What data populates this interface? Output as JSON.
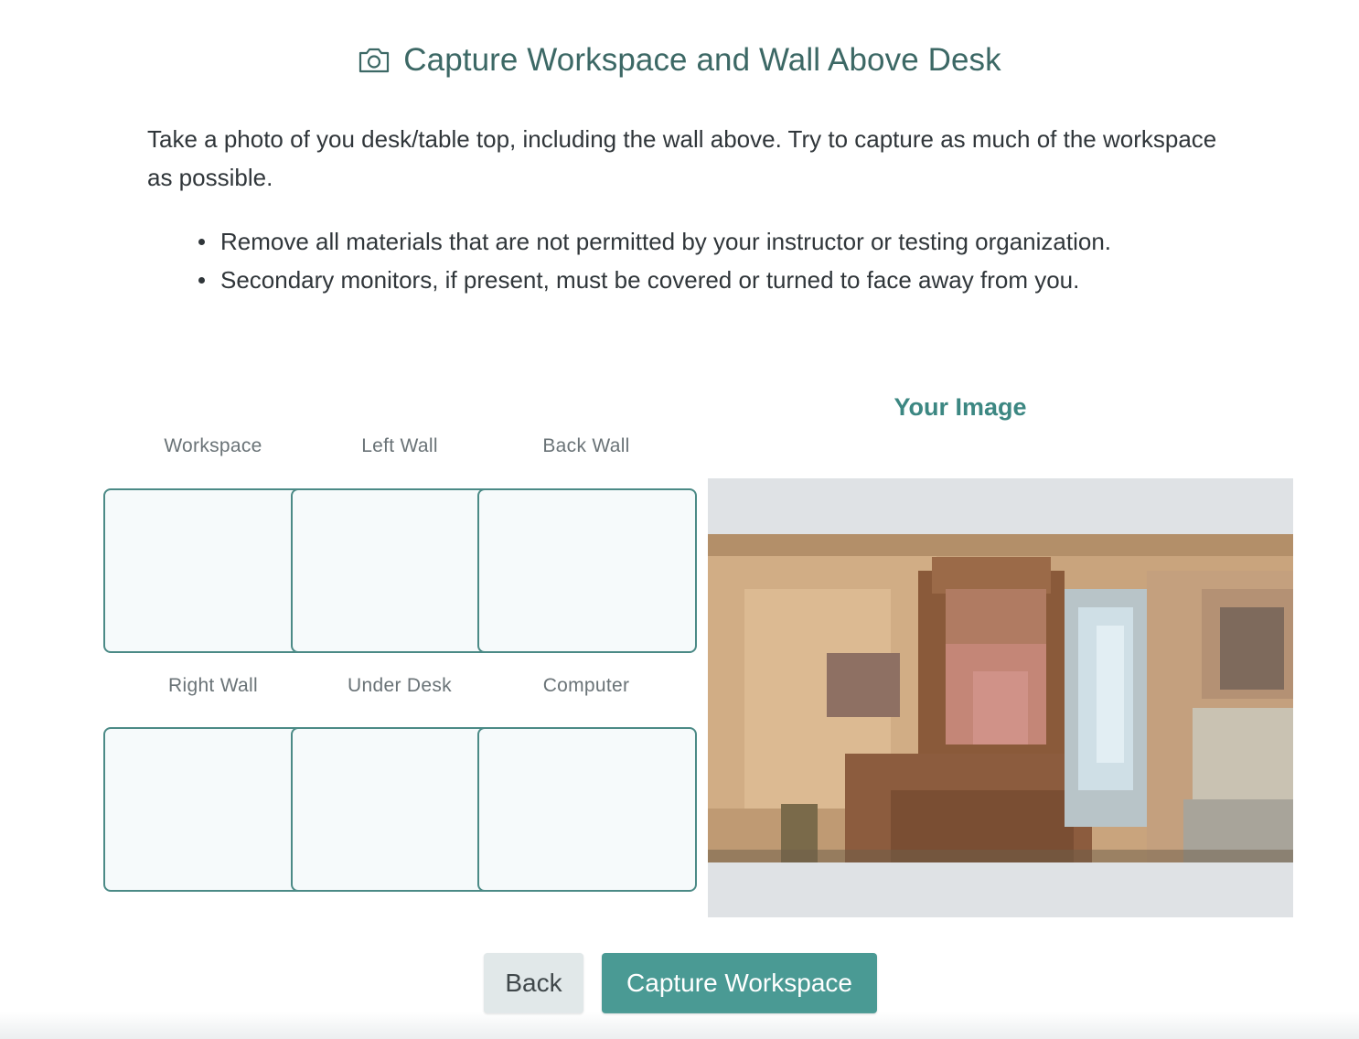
{
  "header": {
    "icon": "camera-icon",
    "title": "Capture Workspace and Wall Above Desk"
  },
  "instructions": {
    "intro": "Take a photo of you desk/table top, including the wall above. Try to capture as much of the workspace as possible.",
    "rules": [
      "Remove all materials that are not permitted by your instructor or testing organization.",
      "Secondary monitors, if present, must be covered or turned to face away from you."
    ]
  },
  "capture_slots": [
    {
      "label": "Workspace"
    },
    {
      "label": "Left Wall"
    },
    {
      "label": "Back Wall"
    },
    {
      "label": "Right Wall"
    },
    {
      "label": "Under Desk"
    },
    {
      "label": "Computer"
    }
  ],
  "preview": {
    "title": "Your Image"
  },
  "actions": {
    "back_label": "Back",
    "capture_label": "Capture Workspace"
  },
  "colors": {
    "accent": "#4a9a94",
    "title": "#3c6865",
    "slot_border": "#4b8a86"
  }
}
